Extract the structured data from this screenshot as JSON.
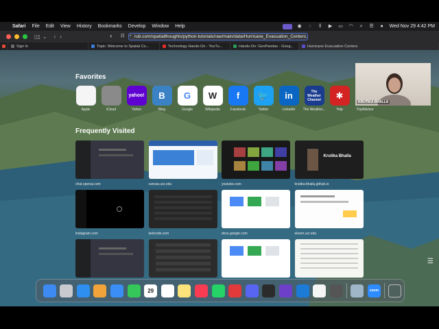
{
  "menubar": {
    "app": "Safari",
    "items": [
      "File",
      "Edit",
      "View",
      "History",
      "Bookmarks",
      "Develop",
      "Window",
      "Help"
    ],
    "datetime": "Wed Nov 29  4:42 PM"
  },
  "toolbar": {
    "url": "rub.com/spatialthoughts/python-tutorials/raw/main/data/Hurricane_Evacuation_Centers.xlsx"
  },
  "tabs": [
    {
      "label": "Sign In",
      "color": "#6c6c6c"
    },
    {
      "label": "Topic: Welcome to Spatial Co...",
      "color": "#3c7dd9"
    },
    {
      "label": "Technology Hands-On - YouTu...",
      "color": "#e0302a"
    },
    {
      "label": "Hands-On: GeoPandas - Goog...",
      "color": "#2d9c5a"
    },
    {
      "label": "Hurricane Evacuation Centers",
      "color": "#5a4fcf"
    }
  ],
  "favorites_title": "Favorites",
  "favorites": [
    {
      "label": "Apple",
      "glyph": "",
      "bg": "#f5f5f5",
      "fg": "#222"
    },
    {
      "label": "iCloud",
      "glyph": "",
      "bg": "#8a8a8a",
      "fg": "#fff"
    },
    {
      "label": "Yahoo",
      "glyph": "yahoo!",
      "bg": "#5f01d1",
      "fg": "#fff"
    },
    {
      "label": "Bing",
      "glyph": "B",
      "bg": "#3b82c4",
      "fg": "#fff"
    },
    {
      "label": "Google",
      "glyph": "G",
      "bg": "#ffffff",
      "fg": "#4285f4"
    },
    {
      "label": "Wikipedia",
      "glyph": "W",
      "bg": "#ffffff",
      "fg": "#222"
    },
    {
      "label": "Facebook",
      "glyph": "f",
      "bg": "#1877f2",
      "fg": "#fff"
    },
    {
      "label": "Twitter",
      "glyph": "🐦",
      "bg": "#1da1f2",
      "fg": "#fff"
    },
    {
      "label": "LinkedIn",
      "glyph": "in",
      "bg": "#0a66c2",
      "fg": "#fff"
    },
    {
      "label": "The Weather...",
      "glyph": "The Weather Channel",
      "bg": "#1a3c8f",
      "fg": "#fff"
    },
    {
      "label": "Yelp",
      "glyph": "✱",
      "bg": "#d32323",
      "fg": "#fff"
    },
    {
      "label": "TripAdvisor",
      "glyph": "◎◎",
      "bg": "#34e0a1",
      "fg": "#000"
    }
  ],
  "frequent_title": "Frequently Visited",
  "frequent": [
    {
      "label": "chat.openai.com",
      "theme": "dark"
    },
    {
      "label": "canvas.ucr.edu",
      "theme": "light-blue"
    },
    {
      "label": "youtube.com",
      "theme": "dark-grid"
    },
    {
      "label": "krutika-bhalla.github.io",
      "theme": "portfolio"
    },
    {
      "label": "instagram.com",
      "theme": "black"
    },
    {
      "label": "leetcode.com",
      "theme": "dark-code"
    },
    {
      "label": "docs.google.com",
      "theme": "white"
    },
    {
      "label": "elearn.ucr.edu",
      "theme": "white-doc"
    },
    {
      "label": "",
      "theme": "dark"
    },
    {
      "label": "",
      "theme": "dark-list"
    },
    {
      "label": "",
      "theme": "white"
    },
    {
      "label": "",
      "theme": "white-text"
    }
  ],
  "portfolio_name": "Krutika Bhalla",
  "camera": {
    "name": "KRUTIKA BHALLA"
  },
  "dock": {
    "calendar_day": "29",
    "icons": [
      {
        "name": "finder-icon",
        "bg": "#3d8bf2"
      },
      {
        "name": "launchpad-icon",
        "bg": "#c9c9d0"
      },
      {
        "name": "safari-icon",
        "bg": "#2f8ff0"
      },
      {
        "name": "photos-icon",
        "bg": "#f2a33a"
      },
      {
        "name": "mail-icon",
        "bg": "#3a8ef5"
      },
      {
        "name": "facetime-icon",
        "bg": "#35c759"
      },
      {
        "name": "calendar-icon",
        "bg": "#ffffff"
      },
      {
        "name": "reminders-icon",
        "bg": "#ffffff"
      },
      {
        "name": "notes-icon",
        "bg": "#fbe27a"
      },
      {
        "name": "music-icon",
        "bg": "#fa3c52"
      },
      {
        "name": "whatsapp-icon",
        "bg": "#25d366"
      },
      {
        "name": "app-icon",
        "bg": "#e23a3a"
      },
      {
        "name": "discord-icon",
        "bg": "#5865f2"
      },
      {
        "name": "terminal-icon",
        "bg": "#2b2b2b"
      },
      {
        "name": "github-icon",
        "bg": "#6e40c9"
      },
      {
        "name": "vscode-icon",
        "bg": "#1d7bd8"
      },
      {
        "name": "chrome-icon",
        "bg": "#f5f5f5"
      },
      {
        "name": "chatgpt-icon",
        "bg": "#555555"
      },
      {
        "name": "preview-icon",
        "bg": "#9fb6c8"
      },
      {
        "name": "zoom-icon",
        "bg": "#2d8cff"
      }
    ],
    "zoom_label": "zoom"
  }
}
